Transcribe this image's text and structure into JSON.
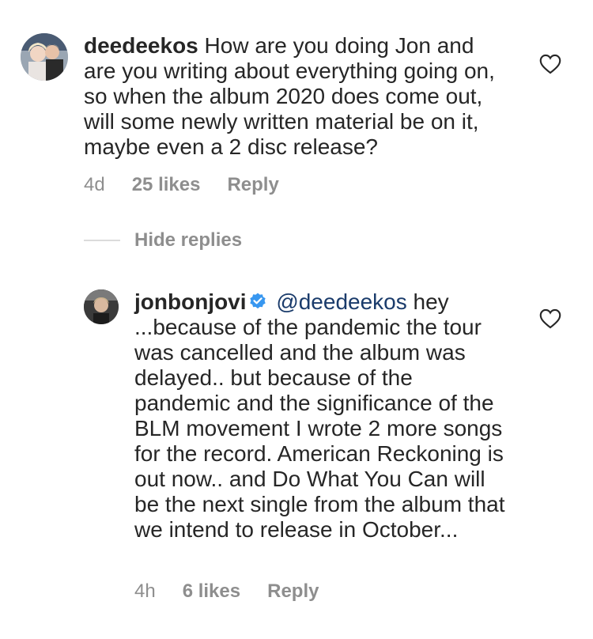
{
  "comments": [
    {
      "username": "deedeekos",
      "text": "How are you doing Jon and are you writing about everything going on, so when the album 2020 does come out, will some newly written material be on it, maybe even a 2 disc release?",
      "age": "4d",
      "likes": "25 likes",
      "reply": "Reply"
    }
  ],
  "hide_replies": "Hide replies",
  "replies": [
    {
      "username": "jonbonjovi",
      "mention": "@deedeekos",
      "text": "hey ...because of the pandemic the tour was cancelled and the album was delayed.. but because of the pandemic and the significance of the BLM  movement I wrote 2 more songs for the record. American Reckoning is out now.. and Do What You Can will be the next single from the album that we intend to release in October...",
      "age": "4h",
      "likes": "6 likes",
      "reply": "Reply"
    }
  ],
  "colors": {
    "text": "#262626",
    "secondary": "#8e8e8e",
    "mention": "#1a3b6b",
    "verified": "#3897f0"
  }
}
